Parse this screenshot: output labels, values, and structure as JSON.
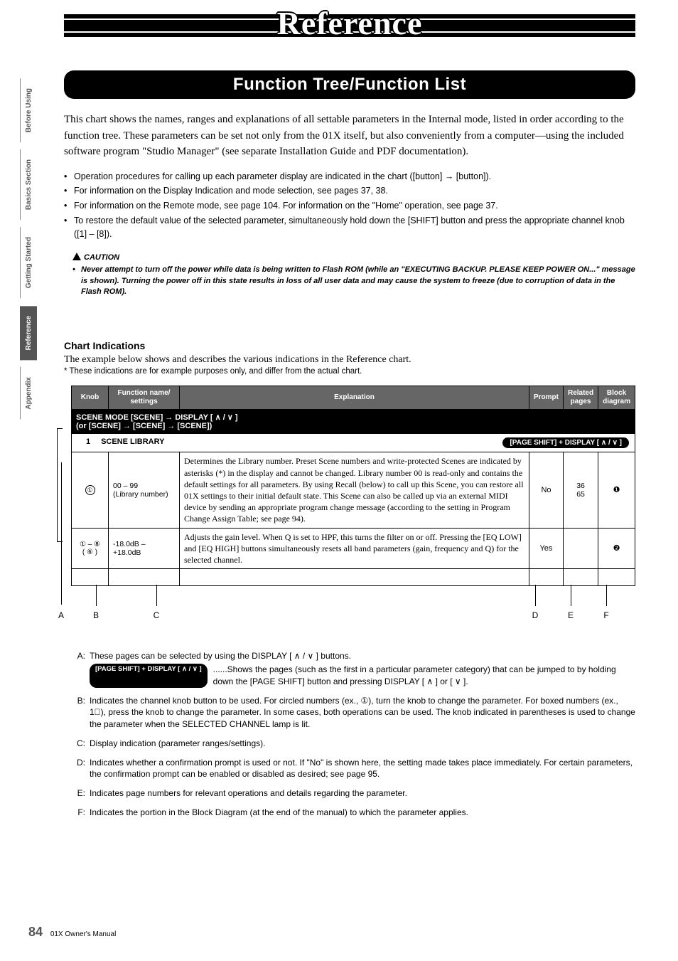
{
  "side_tabs": {
    "t1": "Before Using",
    "t2": "Basics Section",
    "t3": "Getting Started",
    "t4": "Reference",
    "t5": "Appendix"
  },
  "main_title": "Reference",
  "section_title": "Function Tree/Function List",
  "intro": "This chart shows the names, ranges and explanations of all settable parameters in the Internal mode, listed in order according to the function tree.  These parameters can be set not only from the 01X itself, but also conveniently from a computer—using the included software program \"Studio Manager\" (see separate Installation Guide and PDF documentation).",
  "bullets": {
    "b1": "Operation procedures for calling up each parameter display are indicated in the chart ([button] → [button]).",
    "b2": "For information on the Display Indication and mode selection, see pages 37, 38.",
    "b3": "For information on the Remote mode, see page 104. For information on the \"Home\" operation, see page 37.",
    "b4": "To restore the default value of the selected parameter, simultaneously hold down the [SHIFT] button and press the appropriate channel knob ([1] – [8])."
  },
  "caution_label": "CAUTION",
  "caution_text": "Never attempt to turn off the power while data is being written to Flash ROM (while an \"EXECUTING BACKUP.  PLEASE KEEP POWER ON...\" message is shown). Turning the power off in this state results in loss of all user data and may cause the system to freeze (due to corruption of data in the Flash ROM).",
  "chart_heading": "Chart Indications",
  "chart_sub1": "The example below shows and describes the various indications in the Reference chart.",
  "chart_sub2": "* These indications are for example purposes only, and differ from the actual chart.",
  "table": {
    "headers": {
      "knob": "Knob",
      "func": "Function name/\nsettings",
      "expl": "Explanation",
      "prompt": "Prompt",
      "pages": "Related\npages",
      "block": "Block\ndiagram"
    },
    "mode_row": "SCENE MODE     [SCENE] → DISPLAY [ ∧ / ∨ ]\n(or [SCENE] → [SCENE] → [SCENE])",
    "lib_row": {
      "num": "1",
      "label": "SCENE LIBRARY",
      "pill": "[PAGE SHIFT] + DISPLAY [ ∧ / ∨ ]"
    },
    "row1": {
      "knob": "①",
      "func_line1": "00 – 99",
      "func_line2": "(Library number)",
      "expl": "Determines the Library number.  Preset Scene numbers and write-protected Scenes are indicated by asterisks (*) in the display and cannot be changed.  Library number 00 is read-only and contains the default settings for all parameters.  By using Recall (below) to call up this Scene, you can restore all 01X settings to their initial default state.  This Scene can also be called up via an external MIDI device by sending an appropriate program change message (according to the setting in Program Change Assign Table; see page 94).",
      "prompt": "No",
      "pages": "36\n65",
      "block": "❶"
    },
    "row2": {
      "knob": "① – ⑧\n( ⑥ )",
      "func": "-18.0dB – +18.0dB",
      "expl": "Adjusts the gain level.  When Q is set to HPF, this turns the filter on or off.  Pressing the [EQ LOW] and [EQ HIGH] buttons simultaneously resets all band parameters (gain, frequency and Q) for the selected channel.",
      "prompt": "Yes",
      "pages": "",
      "block": "❷"
    }
  },
  "callouts": {
    "a": "A",
    "b": "B",
    "c": "C",
    "d": "D",
    "e": "E",
    "f": "F"
  },
  "defs": {
    "a_key": "A:",
    "a_val": "These pages can be selected by using the DISPLAY [ ∧ / ∨ ] buttons.",
    "a_pill": "[PAGE SHIFT] + DISPLAY [ ∧ / ∨ ]",
    "a_pill_tail": "......Shows the pages (such as the first in a particular parameter category) that can be jumped to by holding down the [PAGE SHIFT] button and pressing DISPLAY [ ∧ ] or [ ∨ ].",
    "b_key": "B:",
    "b_val": "Indicates the channel knob button to be used.  For circled numbers (ex., ①), turn the knob to change the parameter.  For boxed numbers (ex., 1⃣), press the knob to change the parameter.  In some cases, both operations can be used.  The knob indicated in parentheses is used to change the parameter when the SELECTED CHANNEL lamp is lit.",
    "c_key": "C:",
    "c_val": "Display indication (parameter ranges/settings).",
    "d_key": "D:",
    "d_val": "Indicates whether a confirmation prompt is used or not.  If \"No\" is shown here, the setting made takes place immediately.  For certain parameters, the confirmation prompt can be enabled or disabled as desired; see page 95.",
    "e_key": "E:",
    "e_val": "Indicates page numbers for relevant operations and details regarding the parameter.",
    "f_key": "F:",
    "f_val": "Indicates the portion in the Block Diagram (at the end of the manual) to which the parameter applies."
  },
  "footer": {
    "page": "84",
    "doc": "01X  Owner's Manual"
  }
}
